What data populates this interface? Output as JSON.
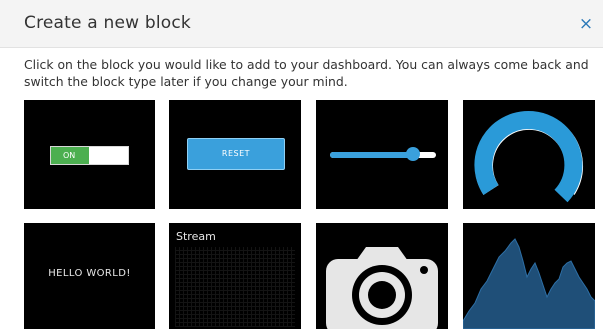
{
  "dialog": {
    "title": "Create a new block",
    "close_icon": "×",
    "description": "Click on the block you would like to add to your dashboard. You can always come back and switch the block type later if you change your mind."
  },
  "blocks": {
    "toggle": {
      "label": "ON",
      "state": "on"
    },
    "momentary_button": {
      "label": "RESET"
    },
    "slider": {
      "value_fraction": 0.82
    },
    "gauge": {
      "value_fraction": 0.88
    },
    "text": {
      "label": "HELLO WORLD!"
    },
    "stream": {
      "label": "Stream"
    },
    "image": {
      "icon": "camera-icon"
    },
    "line_chart": {
      "icon": "area-chart-icon"
    }
  },
  "colors": {
    "accent": "#3aa0dc",
    "toggle_on": "#4caf50",
    "tile_bg": "#000000",
    "chart_fill": "#1f4f78"
  }
}
